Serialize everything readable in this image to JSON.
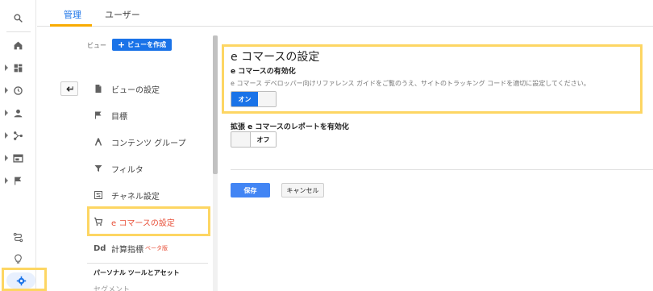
{
  "tabs": {
    "admin": "管理",
    "users": "ユーザー"
  },
  "view": {
    "label": "ビュー",
    "create_button": "ビューを作成",
    "create_icon": "plus-icon"
  },
  "menu": {
    "items": [
      {
        "label": "ビューの設定",
        "icon": "document-icon"
      },
      {
        "label": "目標",
        "icon": "flag-icon"
      },
      {
        "label": "コンテンツ グループ",
        "icon": "person-walk-icon"
      },
      {
        "label": "フィルタ",
        "icon": "filter-icon"
      },
      {
        "label": "チャネル設定",
        "icon": "sliders-icon"
      },
      {
        "label": "e コマースの設定",
        "icon": "cart-icon"
      },
      {
        "label": "計算指標",
        "badge": "ベータ版",
        "icon_text": "Dd"
      }
    ],
    "section_title": "パーソナル ツールとアセット",
    "next_item": "セグメント"
  },
  "ecommerce": {
    "title": "e コマースの設定",
    "enable_label": "e コマースの有効化",
    "description": "e コマース デベロッパー向けリファレンス ガイドをご覧のうえ、サイトのトラッキング コードを適切に設定してください。",
    "toggle_on_label": "オン",
    "enhanced_label": "拡張 e コマースのレポートを有効化",
    "toggle_off_label": "オフ"
  },
  "buttons": {
    "save": "保存",
    "cancel": "キャンセル"
  },
  "colors": {
    "accent": "#1a73e8",
    "highlight": "#fdd663",
    "active_text": "#e8513a"
  }
}
